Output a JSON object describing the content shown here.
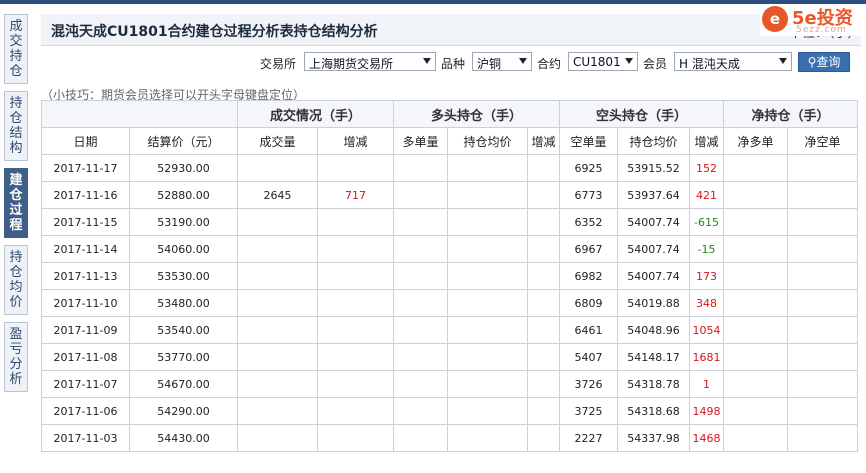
{
  "side_tabs": [
    {
      "label": "成交持仓",
      "active": false
    },
    {
      "label": "持仓结构",
      "active": false
    },
    {
      "label": "建仓过程",
      "active": true
    },
    {
      "label": "持仓均价",
      "active": false
    },
    {
      "label": "盈亏分析",
      "active": false
    }
  ],
  "header": {
    "title": "混沌天成CU1801合约建仓过程分析表持仓结构分析",
    "unit": "单位：（手）"
  },
  "logo": {
    "mark": "e",
    "text": "5e投资",
    "url": "5ezz.com"
  },
  "filters": {
    "exchange_label": "交易所",
    "exchange_value": "上海期货交易所",
    "variety_label": "品种",
    "variety_value": "沪铜",
    "contract_label": "合约",
    "contract_value": "CU1801",
    "member_label": "会员",
    "member_value": "H 混沌天成",
    "query_label": "查询"
  },
  "tip": "（小技巧：期货会员选择可以开头字母键盘定位）",
  "table": {
    "groups": [
      "成交情况（手）",
      "多头持仓（手）",
      "空头持仓（手）",
      "净持仓（手）"
    ],
    "columns": [
      "日期",
      "结算价（元）",
      "成交量",
      "增减",
      "多单量",
      "持仓均价",
      "增减",
      "空单量",
      "持仓均价",
      "增减",
      "净多单",
      "净空单"
    ],
    "rows": [
      {
        "date": "2017-11-17",
        "price": "52930.00",
        "vol": "",
        "vol_chg": "",
        "long": "",
        "long_avg": "",
        "long_chg": "",
        "short": "6925",
        "short_avg": "53915.52",
        "short_chg": "152",
        "short_sign": "pos",
        "net_long": "",
        "net_short": ""
      },
      {
        "date": "2017-11-16",
        "price": "52880.00",
        "vol": "2645",
        "vol_chg": "717",
        "long": "",
        "long_avg": "",
        "long_chg": "",
        "short": "6773",
        "short_avg": "53937.64",
        "short_chg": "421",
        "short_sign": "pos",
        "net_long": "",
        "net_short": ""
      },
      {
        "date": "2017-11-15",
        "price": "53190.00",
        "vol": "",
        "vol_chg": "",
        "long": "",
        "long_avg": "",
        "long_chg": "",
        "short": "6352",
        "short_avg": "54007.74",
        "short_chg": "-615",
        "short_sign": "neg",
        "net_long": "",
        "net_short": ""
      },
      {
        "date": "2017-11-14",
        "price": "54060.00",
        "vol": "",
        "vol_chg": "",
        "long": "",
        "long_avg": "",
        "long_chg": "",
        "short": "6967",
        "short_avg": "54007.74",
        "short_chg": "-15",
        "short_sign": "neg",
        "net_long": "",
        "net_short": ""
      },
      {
        "date": "2017-11-13",
        "price": "53530.00",
        "vol": "",
        "vol_chg": "",
        "long": "",
        "long_avg": "",
        "long_chg": "",
        "short": "6982",
        "short_avg": "54007.74",
        "short_chg": "173",
        "short_sign": "pos",
        "net_long": "",
        "net_short": ""
      },
      {
        "date": "2017-11-10",
        "price": "53480.00",
        "vol": "",
        "vol_chg": "",
        "long": "",
        "long_avg": "",
        "long_chg": "",
        "short": "6809",
        "short_avg": "54019.88",
        "short_chg": "348",
        "short_sign": "pos",
        "net_long": "",
        "net_short": ""
      },
      {
        "date": "2017-11-09",
        "price": "53540.00",
        "vol": "",
        "vol_chg": "",
        "long": "",
        "long_avg": "",
        "long_chg": "",
        "short": "6461",
        "short_avg": "54048.96",
        "short_chg": "1054",
        "short_sign": "pos",
        "net_long": "",
        "net_short": ""
      },
      {
        "date": "2017-11-08",
        "price": "53770.00",
        "vol": "",
        "vol_chg": "",
        "long": "",
        "long_avg": "",
        "long_chg": "",
        "short": "5407",
        "short_avg": "54148.17",
        "short_chg": "1681",
        "short_sign": "pos",
        "net_long": "",
        "net_short": ""
      },
      {
        "date": "2017-11-07",
        "price": "54670.00",
        "vol": "",
        "vol_chg": "",
        "long": "",
        "long_avg": "",
        "long_chg": "",
        "short": "3726",
        "short_avg": "54318.78",
        "short_chg": "1",
        "short_sign": "pos",
        "net_long": "",
        "net_short": ""
      },
      {
        "date": "2017-11-06",
        "price": "54290.00",
        "vol": "",
        "vol_chg": "",
        "long": "",
        "long_avg": "",
        "long_chg": "",
        "short": "3725",
        "short_avg": "54318.68",
        "short_chg": "1498",
        "short_sign": "pos",
        "net_long": "",
        "net_short": ""
      },
      {
        "date": "2017-11-03",
        "price": "54430.00",
        "vol": "",
        "vol_chg": "",
        "long": "",
        "long_avg": "",
        "long_chg": "",
        "short": "2227",
        "short_avg": "54337.98",
        "short_chg": "1468",
        "short_sign": "pos",
        "net_long": "",
        "net_short": ""
      }
    ]
  },
  "colors": {
    "positive": "#d7151b",
    "negative": "#1c8a1c",
    "accent": "#3a6fb0",
    "logo": "#e8572a"
  }
}
